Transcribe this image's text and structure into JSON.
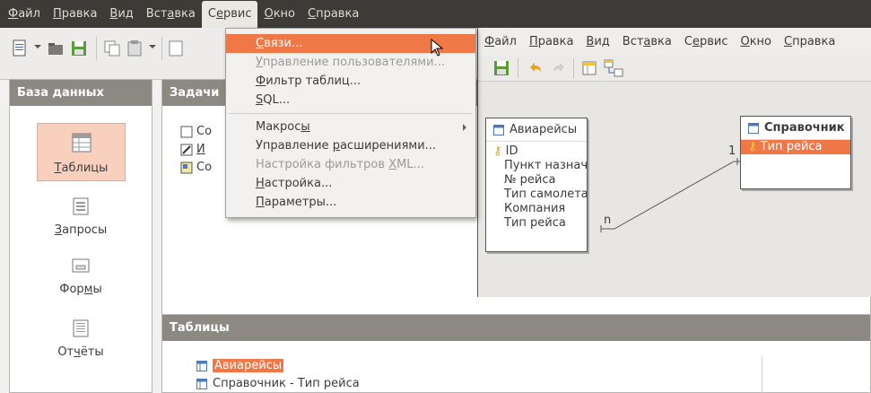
{
  "menubar": {
    "items": [
      {
        "pre": "",
        "u": "Ф",
        "post": "айл"
      },
      {
        "pre": "",
        "u": "П",
        "post": "равка"
      },
      {
        "pre": "",
        "u": "В",
        "post": "ид"
      },
      {
        "pre": "Вст",
        "u": "а",
        "post": "вка"
      },
      {
        "pre": "С",
        "u": "е",
        "post": "рвис"
      },
      {
        "pre": "",
        "u": "О",
        "post": "кно"
      },
      {
        "pre": "",
        "u": "С",
        "post": "правка"
      }
    ]
  },
  "left_pane": {
    "title": "База данных",
    "items": [
      {
        "label_u": "Т",
        "label_rest": "аблицы"
      },
      {
        "label_u": "З",
        "label_rest": "апросы"
      },
      {
        "label_pre": "Фор",
        "label_u": "м",
        "label_rest": "ы"
      },
      {
        "label_pre": "От",
        "label_u": "ч",
        "label_rest": "ёты"
      }
    ]
  },
  "tasks": {
    "title": "Задачи",
    "rows": [
      "Со",
      "И",
      "Со"
    ]
  },
  "tables_pane": {
    "title": "Таблицы",
    "rows": [
      "Авиарейсы",
      "Справочник - Тип рейса"
    ]
  },
  "dropdown": {
    "items": [
      {
        "pre": "",
        "u": "С",
        "post": "вязи...",
        "state": "hi"
      },
      {
        "pre": "",
        "u": "У",
        "post": "правление пользователями...",
        "state": "dis"
      },
      {
        "pre": "",
        "u": "Ф",
        "post": "ильтр таблиц...",
        "state": ""
      },
      {
        "pre": "",
        "u": "S",
        "post": "QL...",
        "state": ""
      },
      {
        "sep": true
      },
      {
        "pre": "Макрос",
        "u": "ы",
        "post": "",
        "state": "",
        "submenu": true
      },
      {
        "pre": "Управление ",
        "u": "р",
        "post": "асширениями...",
        "state": ""
      },
      {
        "pre": "Настройка фильтров ",
        "u": "X",
        "post": "ML...",
        "state": "dis"
      },
      {
        "pre": "",
        "u": "Н",
        "post": "астройка...",
        "state": ""
      },
      {
        "pre": "",
        "u": "П",
        "post": "араметры...",
        "state": ""
      }
    ]
  },
  "relations": {
    "menubar": [
      {
        "pre": "",
        "u": "Ф",
        "post": "айл"
      },
      {
        "pre": "",
        "u": "П",
        "post": "равка"
      },
      {
        "pre": "",
        "u": "В",
        "post": "ид"
      },
      {
        "pre": "Вст",
        "u": "а",
        "post": "вка"
      },
      {
        "pre": "С",
        "u": "е",
        "post": "рвис"
      },
      {
        "pre": "",
        "u": "О",
        "post": "кно"
      },
      {
        "pre": "",
        "u": "С",
        "post": "правка"
      }
    ],
    "table1": {
      "title": "Авиарейсы",
      "fields": [
        "ID",
        "Пункт назначения",
        "№ рейса",
        "Тип самолета",
        "Компания",
        "Тип рейса"
      ]
    },
    "table2": {
      "title": "Справочник",
      "fields": [
        "Тип рейса"
      ]
    },
    "label_one": "1",
    "label_many": "n"
  },
  "colors": {
    "highlight": "#f07746",
    "menubar_bg": "#3c3b37",
    "pane_header": "#8b8982"
  }
}
